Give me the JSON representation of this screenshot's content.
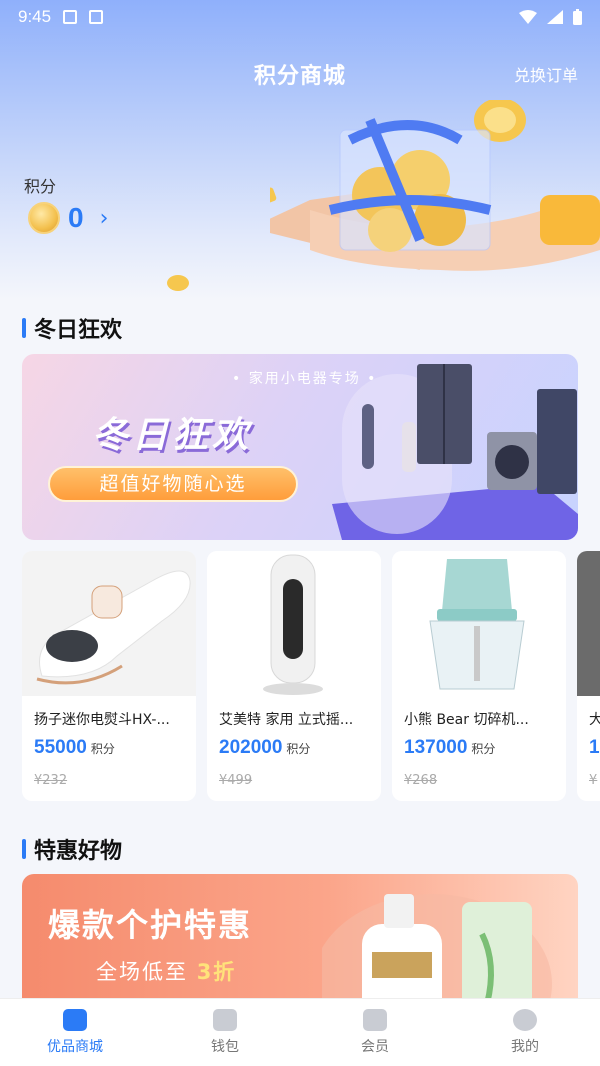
{
  "status_bar": {
    "time": "9:45"
  },
  "header": {
    "title": "积分商城",
    "orders_link": "兑换订单"
  },
  "points": {
    "label": "积分",
    "value": "0",
    "arrow": "›"
  },
  "section_winter": {
    "title": "冬日狂欢",
    "banner": {
      "subtitle": "• 家用小电器专场 •",
      "headline": "冬日狂欢",
      "pill": "超值好物随心选"
    }
  },
  "products": [
    {
      "name": "扬子迷你电熨斗HX-...",
      "points": "55000",
      "unit": "积分",
      "original_price": "¥232"
    },
    {
      "name": "艾美特 家用 立式摇...",
      "points": "202000",
      "unit": "积分",
      "original_price": "¥499"
    },
    {
      "name": "小熊 Bear  切碎机...",
      "points": "137000",
      "unit": "积分",
      "original_price": "¥268"
    },
    {
      "name": "大",
      "points": "1",
      "unit": "",
      "original_price": "¥"
    }
  ],
  "section_deals": {
    "title": "特惠好物",
    "banner": {
      "headline": "爆款个护特惠",
      "sub_prefix": "全场低至",
      "sub_highlight": "3折"
    }
  },
  "tabs": [
    {
      "label": "优品商城",
      "icon": "shopping-bag-icon",
      "active": true
    },
    {
      "label": "钱包",
      "icon": "wallet-icon",
      "active": false
    },
    {
      "label": "会员",
      "icon": "vip-icon",
      "active": false
    },
    {
      "label": "我的",
      "icon": "profile-icon",
      "active": false
    }
  ],
  "colors": {
    "accent": "#2b7bf6"
  }
}
